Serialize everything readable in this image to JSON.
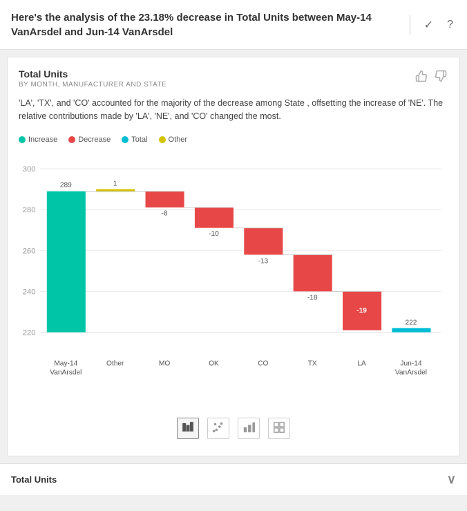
{
  "header": {
    "title": "Here's the analysis of the 23.18% decrease in Total Units between May-14 VanArsdel and Jun-14 VanArsdel",
    "checkmark_icon": "✓",
    "help_icon": "?"
  },
  "card": {
    "title": "Total Units",
    "subtitle": "BY MONTH, MANUFACTURER AND STATE",
    "description": "'LA', 'TX', and 'CO' accounted for the majority of the decrease among State , offsetting the increase of 'NE'. The relative contributions made by 'LA', 'NE', and 'CO' changed the most.",
    "thumbup_icon": "👍",
    "thumbdown_icon": "👎"
  },
  "legend": [
    {
      "label": "Increase",
      "color": "#00c5a7"
    },
    {
      "label": "Decrease",
      "color": "#e84747"
    },
    {
      "label": "Total",
      "color": "#00bcd4"
    },
    {
      "label": "Other",
      "color": "#d4c300"
    }
  ],
  "chart": {
    "y_labels": [
      "300",
      "280",
      "260",
      "240",
      "220"
    ],
    "bars": [
      {
        "label": "May-14\nVanArsdel",
        "value": 289,
        "top_label": "289",
        "type": "total",
        "color": "#00c5a7"
      },
      {
        "label": "Other",
        "value": 1,
        "top_label": "1",
        "type": "other",
        "color": "#d4c300"
      },
      {
        "label": "MO",
        "value": -8,
        "top_label": "-8",
        "type": "decrease",
        "color": "#e84747"
      },
      {
        "label": "OK",
        "value": -10,
        "top_label": "-10",
        "type": "decrease",
        "color": "#e84747"
      },
      {
        "label": "CO",
        "value": -13,
        "top_label": "-13",
        "type": "decrease",
        "color": "#e84747"
      },
      {
        "label": "TX",
        "value": -18,
        "top_label": "-18",
        "type": "decrease",
        "color": "#e84747"
      },
      {
        "label": "LA",
        "value": -19,
        "top_label": "-19",
        "type": "decrease",
        "color": "#e84747"
      },
      {
        "label": "Jun-14\nVanArsdel",
        "value": 222,
        "top_label": "222",
        "type": "total",
        "color": "#00bcd4"
      }
    ]
  },
  "chart_controls": [
    {
      "icon": "▦",
      "label": "bar-chart-icon",
      "active": true
    },
    {
      "icon": "⁞⁞",
      "label": "scatter-icon",
      "active": false
    },
    {
      "icon": "▐▌",
      "label": "column-icon",
      "active": false
    },
    {
      "icon": "⋮⋮",
      "label": "grid-icon",
      "active": false
    }
  ],
  "bottom_section": {
    "label": "Total Units",
    "arrow": "∨"
  }
}
